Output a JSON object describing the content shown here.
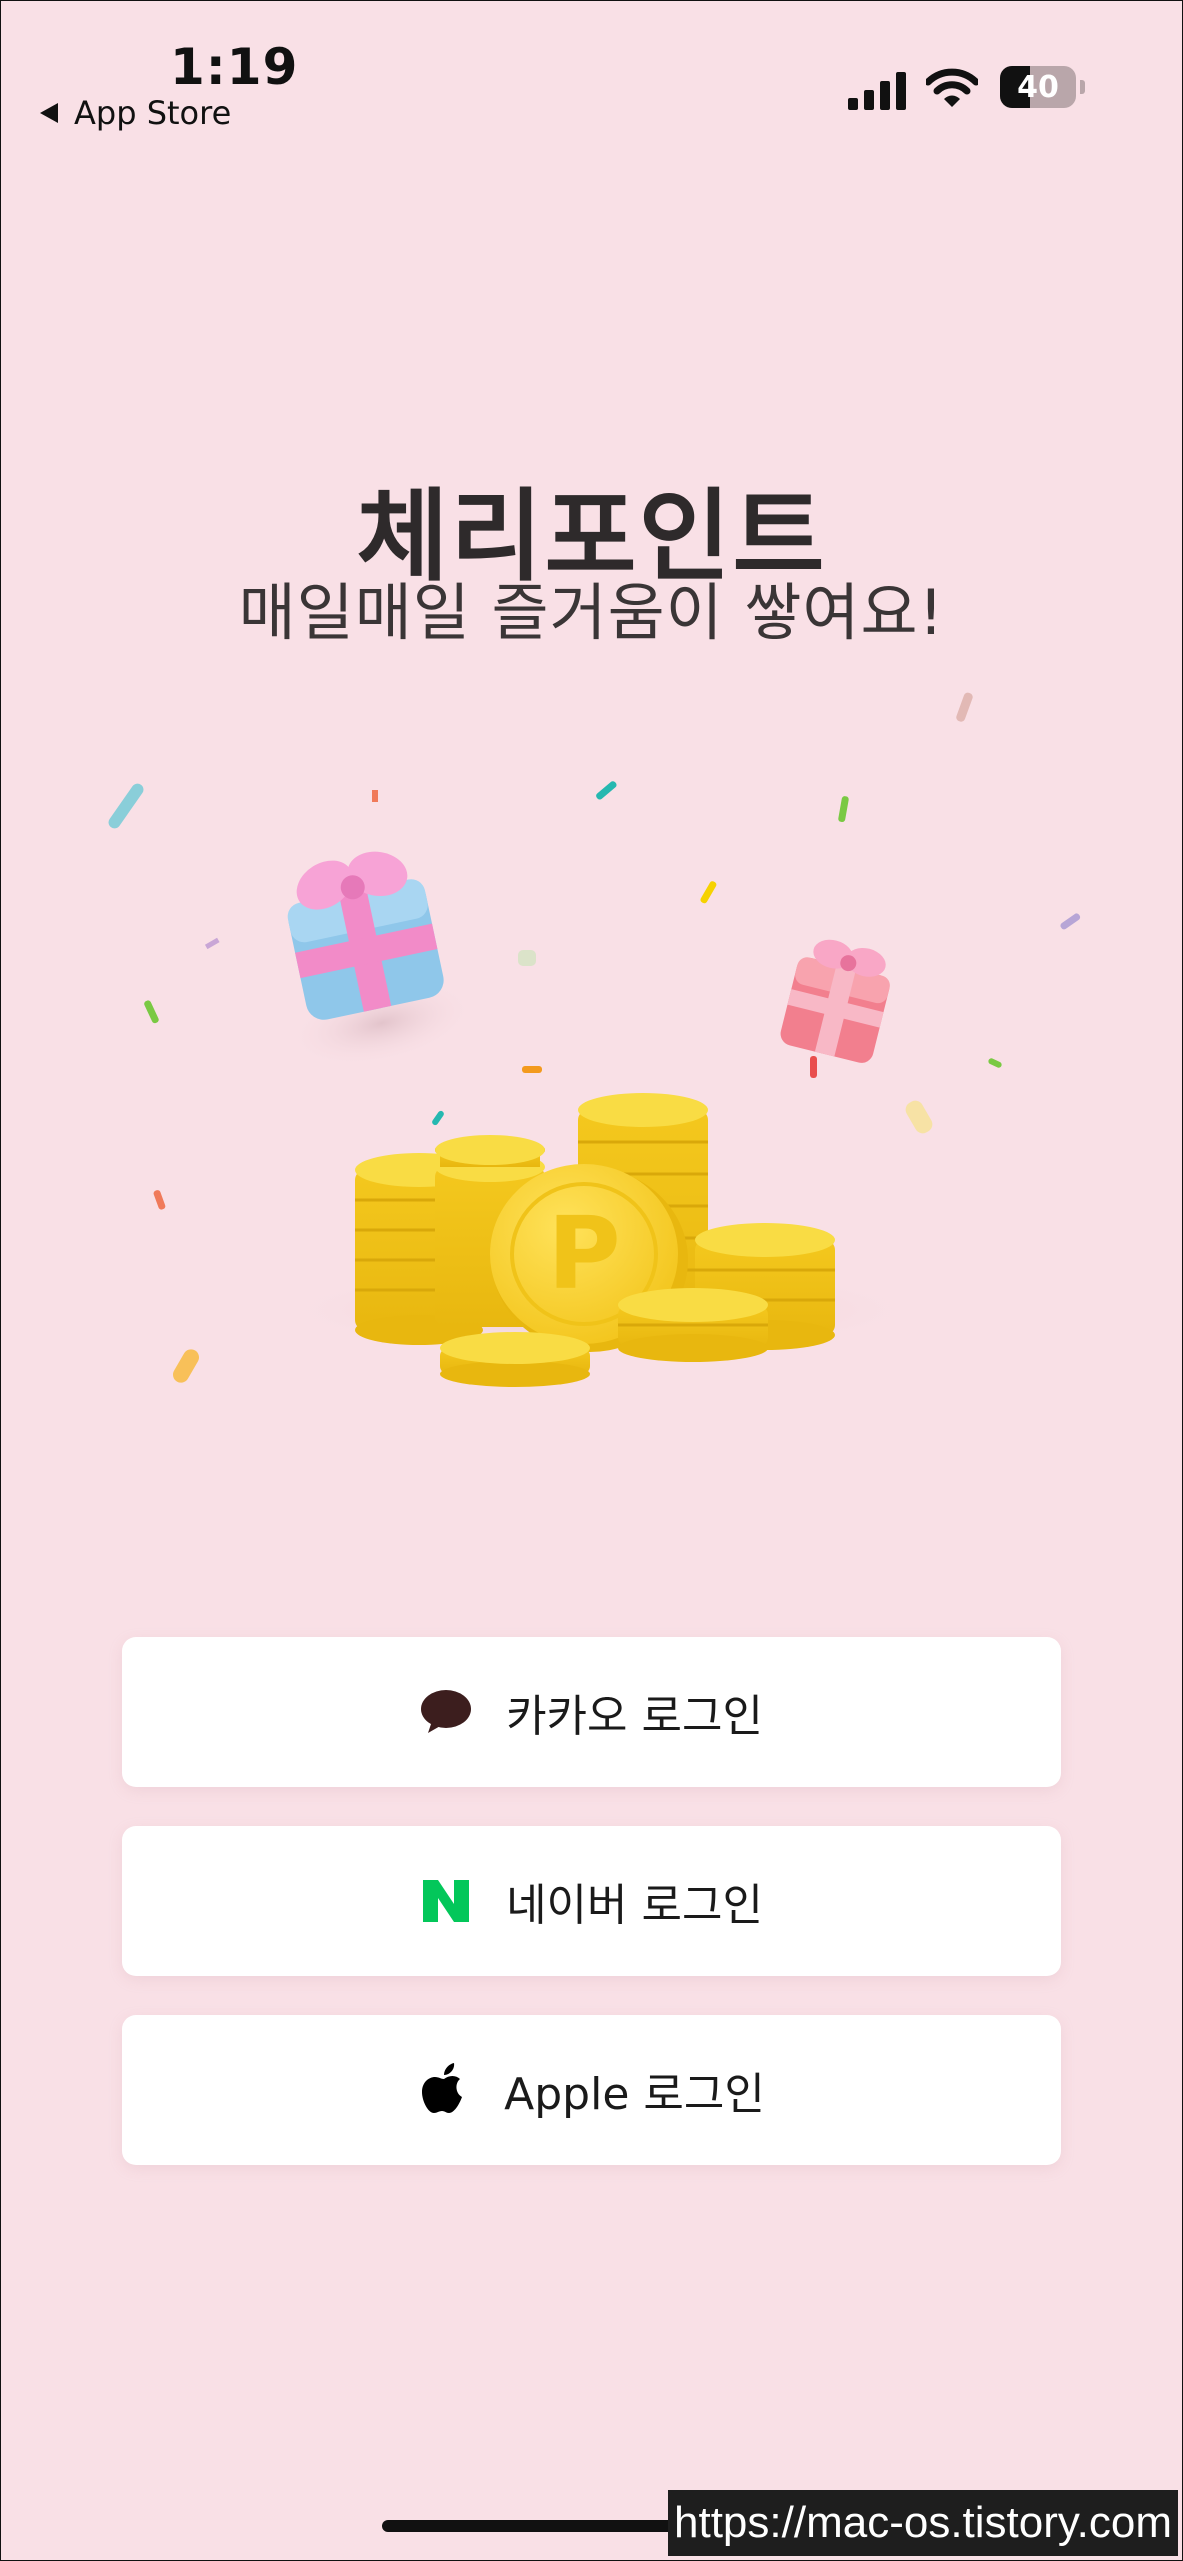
{
  "status_bar": {
    "time": "1:19",
    "back_label": "App Store",
    "battery_percent": "40",
    "battery_level": 0.4
  },
  "brand": {
    "title": "체리포인트",
    "tagline": "매일매일 즐거움이 쌓여요!"
  },
  "illustration": {
    "coin_mark": "P"
  },
  "login": {
    "kakao": {
      "label": "카카오 로그인",
      "icon": "kakao-talk-bubble-icon",
      "color": "#3c1e1e"
    },
    "naver": {
      "label": "네이버 로그인",
      "icon": "naver-n-icon",
      "color": "#03c75a"
    },
    "apple": {
      "label": "Apple 로그인",
      "icon": "apple-logo-icon",
      "color": "#000000"
    }
  },
  "watermark": "https://mac-os.tistory.com",
  "colors": {
    "background": "#f9e0e6",
    "coin": "#f7d53a",
    "button": "#ffffff"
  }
}
